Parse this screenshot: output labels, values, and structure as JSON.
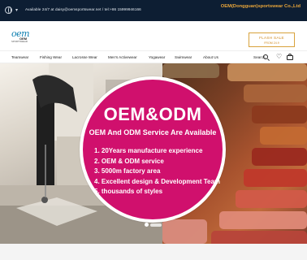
{
  "topbar": {
    "contact": "Available 24/7 at daisy@oemsportswear.net / tel:+86 15999946166",
    "company": "OEM(Dongguan)sportswear Co.,Ltd"
  },
  "header": {
    "logo_mark": "oem",
    "logo_brand": "OEM",
    "logo_tag": "SPORTSWEAR",
    "flash_sale": "FLASH SALE",
    "flash_sub": "FROM 24.9"
  },
  "nav": {
    "items": [
      "Teamwear",
      "Fishing Wear",
      "Lacrosse Wear",
      "Men's Activewear",
      "Yogawear",
      "Swimwear",
      "About Us"
    ],
    "search_label": "Search"
  },
  "hero": {
    "title": "OEM&ODM",
    "subtitle": "OEM And ODM Service Are Available",
    "points": [
      "1. 20Years manufacture experience",
      "2. OEM & ODM service",
      "3. 5000m factory area",
      "4. Excellent design & Development Team",
      "5. thousands of styles"
    ]
  },
  "colors": {
    "topbar_bg": "#0d1e33",
    "accent_gold": "#e8a53a",
    "hero_magenta": "#d0106d"
  }
}
